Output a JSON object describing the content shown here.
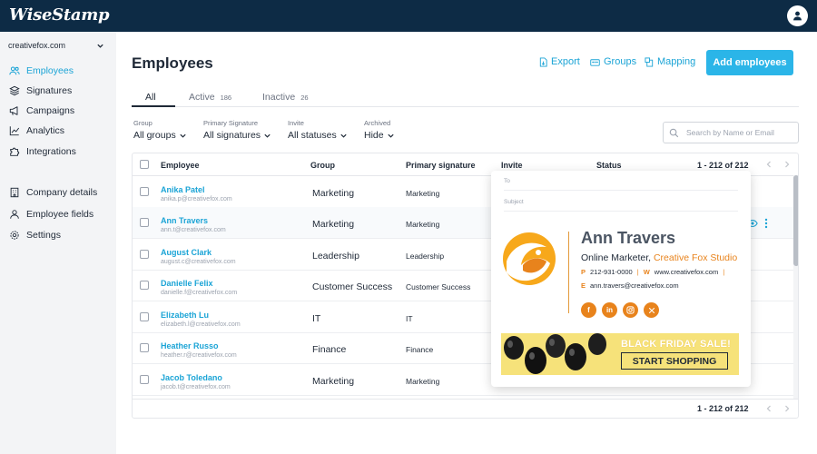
{
  "app": {
    "logo": "WiseStamp"
  },
  "sidebar": {
    "account": "creativefox.com",
    "items": [
      {
        "label": "Employees",
        "icon": "users-icon",
        "active": true
      },
      {
        "label": "Signatures",
        "icon": "layers-icon"
      },
      {
        "label": "Campaigns",
        "icon": "megaphone-icon"
      },
      {
        "label": "Analytics",
        "icon": "chart-line-icon"
      },
      {
        "label": "Integrations",
        "icon": "puzzle-icon"
      },
      {
        "label": "Company details",
        "icon": "building-icon"
      },
      {
        "label": "Employee fields",
        "icon": "person-icon"
      },
      {
        "label": "Settings",
        "icon": "gear-icon"
      }
    ]
  },
  "header": {
    "title": "Employees",
    "export_label": "Export",
    "groups_label": "Groups",
    "mapping_label": "Mapping",
    "add_label": "Add employees"
  },
  "tabs": [
    {
      "label": "All",
      "count": ""
    },
    {
      "label": "Active",
      "count": "186"
    },
    {
      "label": "Inactive",
      "count": "26"
    }
  ],
  "filters": [
    {
      "label": "Group",
      "value": "All groups"
    },
    {
      "label": "Primary Signature",
      "value": "All signatures"
    },
    {
      "label": "Invite",
      "value": "All statuses"
    },
    {
      "label": "Archived",
      "value": "Hide"
    }
  ],
  "search": {
    "placeholder": "Search by Name or Email"
  },
  "table": {
    "columns": [
      "Employee",
      "Group",
      "Primary signature",
      "Invite",
      "Status"
    ],
    "pagination": "1 - 212 of 212",
    "rows": [
      {
        "name": "Anika Patel",
        "email": "anika.p@creativefox.com",
        "group": "Marketing",
        "signature": "Marketing"
      },
      {
        "name": "Ann Travers",
        "email": "ann.t@creativefox.com",
        "group": "Marketing",
        "signature": "Marketing"
      },
      {
        "name": "August Clark",
        "email": "august.c@creativefox.com",
        "group": "Leadership",
        "signature": "Leadership"
      },
      {
        "name": "Danielle Felix",
        "email": "danielle.f@creativefox.com",
        "group": "Customer Success",
        "signature": "Customer Success"
      },
      {
        "name": "Elizabeth Lu",
        "email": "elizabeth.l@creativefox.com",
        "group": "IT",
        "signature": "IT"
      },
      {
        "name": "Heather Russo",
        "email": "heather.r@creativefox.com",
        "group": "Finance",
        "signature": "Finance"
      },
      {
        "name": "Jacob Toledano",
        "email": "jacob.t@creativefox.com",
        "group": "Marketing",
        "signature": "Marketing"
      }
    ]
  },
  "preview": {
    "to_label": "To",
    "subject_label": "Subject",
    "name": "Ann Travers",
    "title": "Online Marketer,",
    "company": "Creative Fox Studio",
    "phone_key": "P",
    "phone": "212-931-0000",
    "web_key": "W",
    "web": "www.creativefox.com",
    "email_key": "E",
    "email": "ann.travers@creativefox.com",
    "socials": [
      "facebook-icon",
      "linkedin-icon",
      "instagram-icon",
      "x-twitter-icon"
    ],
    "banner_title": "BLACK FRIDAY SALE!",
    "banner_cta": "START SHOPPING"
  },
  "colors": {
    "topbar": "#0d2b45",
    "accent": "#1ba4d6",
    "button": "#2bb5e8",
    "signature_accent": "#e8831c",
    "banner": "#f6e27a"
  }
}
